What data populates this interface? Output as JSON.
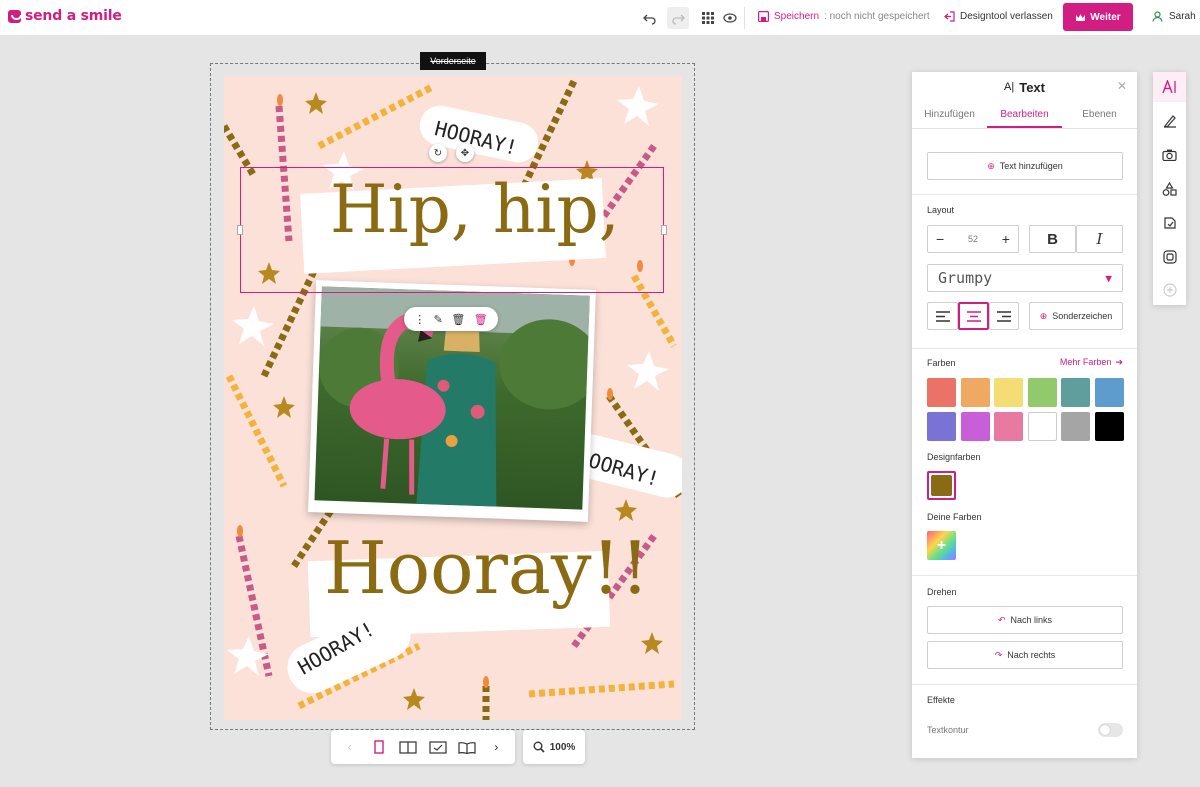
{
  "brand": {
    "name": "send a smile",
    "color": "#d21e82"
  },
  "topbar": {
    "undo_icon": "undo-icon",
    "redo_icon": "redo-icon",
    "grid_icon": "grid-icon",
    "preview_icon": "eye-icon",
    "save_label": "Speichern",
    "save_status": ": noch nicht gespeichert",
    "leave_label": "Designtool verlassen",
    "next_label": "Weiter",
    "user_name": "Sarah"
  },
  "canvas": {
    "side_label": "Vorderseite",
    "headline": "Hip, hip,",
    "headline_bottom": "Hooray!!",
    "hooray_small": "HOORAY!",
    "text_color": "#8b6a14",
    "background_color": "#fbe1d8"
  },
  "image_toolbar": {
    "more": "more-vertical-icon",
    "magic": "magic-wand-icon",
    "layer": "trash-outline-icon",
    "delete": "delete-icon"
  },
  "bottom": {
    "zoom": "100%"
  },
  "panel": {
    "title": "Text",
    "tabs": [
      "Hinzufügen",
      "Bearbeiten",
      "Ebenen"
    ],
    "active_tab": "Bearbeiten",
    "add_text_label": "Text hinzufügen",
    "layout_label": "Layout",
    "font_size": "52",
    "font_name": "Grumpy",
    "special_chars_label": "Sonderzeichen",
    "colors_label": "Farben",
    "more_colors_label": "Mehr Farben",
    "colors": [
      "#ea7266",
      "#f0a963",
      "#f4dd74",
      "#92c96b",
      "#5f9e9d",
      "#5e9ccd",
      "#7a72d4",
      "#c85fd8",
      "#e87aa2",
      "#ffffff",
      "#a5a5a5",
      "#000000"
    ],
    "design_colors_label": "Designfarben",
    "design_color": "#8b6a14",
    "your_colors_label": "Deine Farben",
    "rotate_label": "Drehen",
    "rotate_left_label": "Nach links",
    "rotate_right_label": "Nach rechts",
    "effects_label": "Effekte",
    "text_outline_label": "Textkontur",
    "text_outline_on": false
  },
  "rail": [
    "text-icon",
    "draw-icon",
    "camera-icon",
    "shapes-icon",
    "sticker-icon",
    "frame-icon",
    "add-icon"
  ]
}
